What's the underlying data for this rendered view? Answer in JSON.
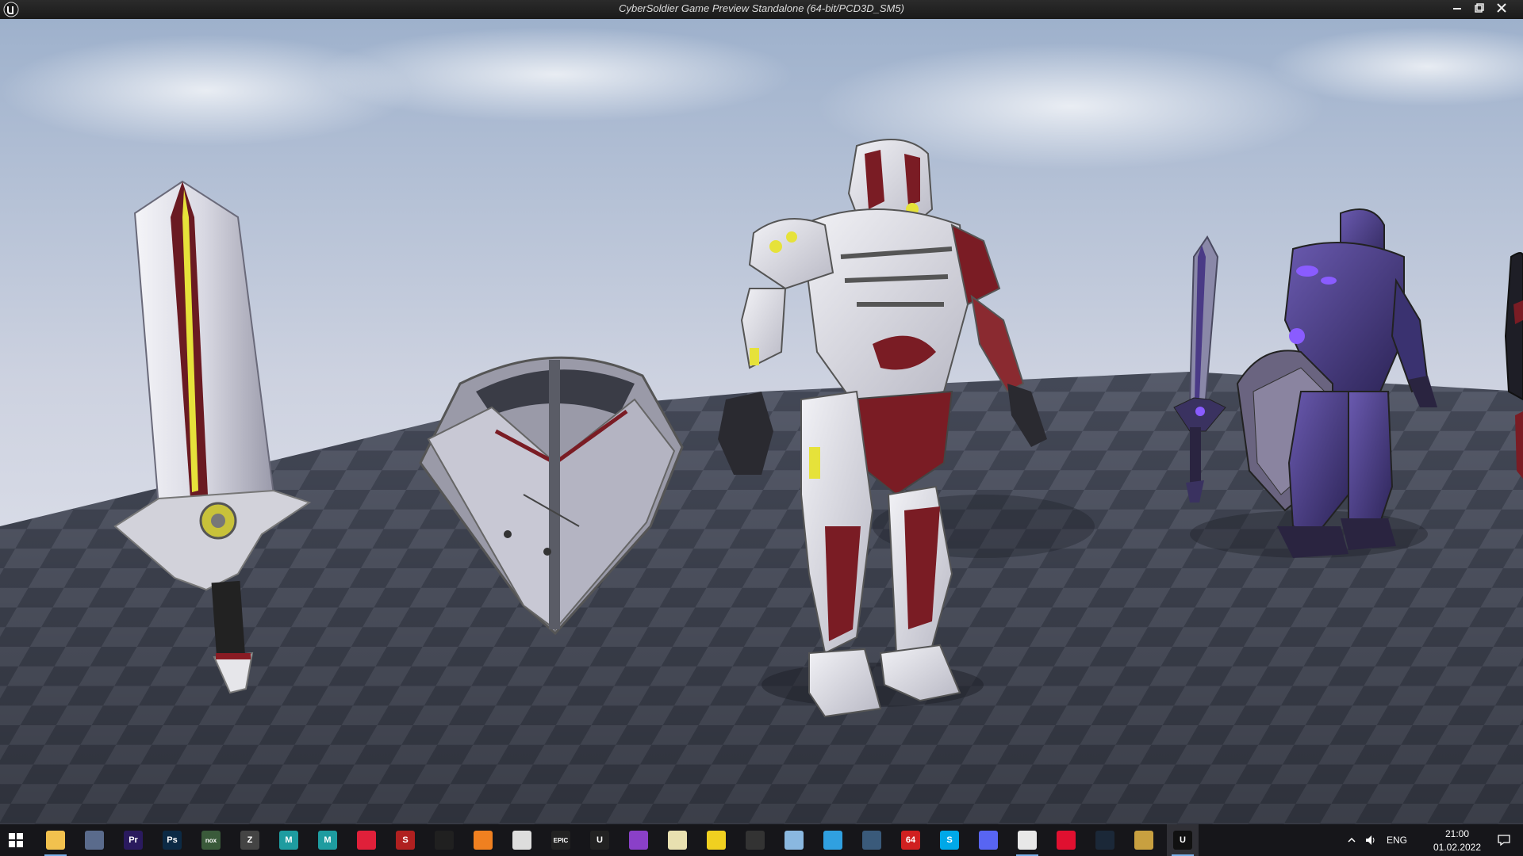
{
  "window": {
    "title": "CyberSoldier Game Preview Standalone (64-bit/PCD3D_SM5)",
    "app_icon": "unreal-engine-icon",
    "controls": [
      "minimize-icon",
      "restore-icon",
      "close-icon"
    ]
  },
  "scene": {
    "objects": [
      "sword-white",
      "shield-white",
      "cyber-soldier-white",
      "sword-purple",
      "cyber-soldier-purple-with-shield",
      "cyber-soldier-partial"
    ],
    "colors": {
      "sky_top": "#9fb3cf",
      "sky_horizon": "#e8e8f0",
      "floor_dark": "#3c4150",
      "floor_light": "#5a5f6e",
      "armor_white": "#dcdde2",
      "armor_red": "#7a1c24",
      "armor_purple": "#4a3a86",
      "glow_yellow": "#e6e23a",
      "glow_violet": "#8a5cff"
    }
  },
  "taskbar": {
    "start_icon": "windows-start-icon",
    "apps": [
      {
        "name": "file-explorer",
        "label": "",
        "color": "#f2c14e",
        "running": true
      },
      {
        "name": "calculator",
        "label": "",
        "color": "#5a6b8c",
        "running": false
      },
      {
        "name": "premiere-pro",
        "label": "Pr",
        "color": "#2a1a5e",
        "running": false
      },
      {
        "name": "photoshop",
        "label": "Ps",
        "color": "#0c2a45",
        "running": false
      },
      {
        "name": "nox-player",
        "label": "nox",
        "color": "#3a5a3a",
        "running": false
      },
      {
        "name": "zbrush",
        "label": "Z",
        "color": "#444444",
        "running": false
      },
      {
        "name": "maya",
        "label": "M",
        "color": "#1e9ca0",
        "running": false
      },
      {
        "name": "maya-2",
        "label": "M",
        "color": "#1e9ca0",
        "running": false
      },
      {
        "name": "app-red-heart",
        "label": "",
        "color": "#e0203a",
        "running": false
      },
      {
        "name": "substance",
        "label": "S",
        "color": "#b02020",
        "running": false
      },
      {
        "name": "app-search-circle",
        "label": "",
        "color": "#202020",
        "running": false
      },
      {
        "name": "blender",
        "label": "",
        "color": "#f08020",
        "running": false
      },
      {
        "name": "unity",
        "label": "",
        "color": "#dddddd",
        "running": false
      },
      {
        "name": "epic-games",
        "label": "EPIC",
        "color": "#222222",
        "running": false
      },
      {
        "name": "unreal-engine",
        "label": "U",
        "color": "#222222",
        "running": false
      },
      {
        "name": "app-spiral",
        "label": "",
        "color": "#8a40c8",
        "running": false
      },
      {
        "name": "app-leaf",
        "label": "",
        "color": "#e8e0b0",
        "running": false
      },
      {
        "name": "app-smiley",
        "label": "",
        "color": "#f0d020",
        "running": false
      },
      {
        "name": "app-hat",
        "label": "",
        "color": "#333333",
        "running": false
      },
      {
        "name": "app-bottle",
        "label": "",
        "color": "#8ab8e0",
        "running": false
      },
      {
        "name": "app-clock",
        "label": "",
        "color": "#30a0e0",
        "running": false
      },
      {
        "name": "app-gamepad",
        "label": "",
        "color": "#3a5a7a",
        "running": false
      },
      {
        "name": "app-64",
        "label": "64",
        "color": "#d02020",
        "running": false
      },
      {
        "name": "skype",
        "label": "S",
        "color": "#00a8e8",
        "running": false
      },
      {
        "name": "discord",
        "label": "",
        "color": "#5865f2",
        "running": false
      },
      {
        "name": "yandex-browser",
        "label": "",
        "color": "#e8e8e8",
        "running": true
      },
      {
        "name": "opera",
        "label": "",
        "color": "#e01030",
        "running": false
      },
      {
        "name": "steam",
        "label": "",
        "color": "#1b2838",
        "running": false
      },
      {
        "name": "league-of-legends",
        "label": "",
        "color": "#c8a040",
        "running": false
      },
      {
        "name": "unreal-editor-running",
        "label": "U",
        "color": "#111111",
        "running": true,
        "active": true
      }
    ],
    "tray": {
      "language": "ENG",
      "time": "21:00",
      "date": "01.02.2022"
    }
  }
}
